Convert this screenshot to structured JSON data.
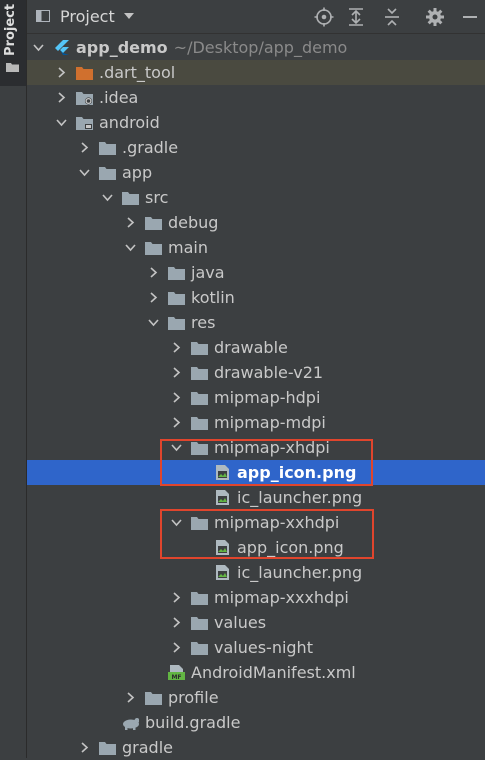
{
  "sidebar": {
    "tab_label": "Project"
  },
  "toolbar": {
    "title": "Project"
  },
  "tree": [
    {
      "label": "app_demo",
      "suffix": "~/Desktop/app_demo",
      "depth": 0,
      "arrow": "down",
      "icon": "flutter",
      "bold": true
    },
    {
      "label": ".dart_tool",
      "depth": 1,
      "arrow": "right",
      "icon": "folder-orange",
      "highlight": true
    },
    {
      "label": ".idea",
      "depth": 1,
      "arrow": "right",
      "icon": "folder-gear"
    },
    {
      "label": "android",
      "depth": 1,
      "arrow": "down",
      "icon": "folder-android"
    },
    {
      "label": ".gradle",
      "depth": 2,
      "arrow": "right",
      "icon": "folder"
    },
    {
      "label": "app",
      "depth": 2,
      "arrow": "down",
      "icon": "folder"
    },
    {
      "label": "src",
      "depth": 3,
      "arrow": "down",
      "icon": "folder"
    },
    {
      "label": "debug",
      "depth": 4,
      "arrow": "right",
      "icon": "folder"
    },
    {
      "label": "main",
      "depth": 4,
      "arrow": "down",
      "icon": "folder"
    },
    {
      "label": "java",
      "depth": 5,
      "arrow": "right",
      "icon": "folder"
    },
    {
      "label": "kotlin",
      "depth": 5,
      "arrow": "right",
      "icon": "folder"
    },
    {
      "label": "res",
      "depth": 5,
      "arrow": "down",
      "icon": "folder"
    },
    {
      "label": "drawable",
      "depth": 6,
      "arrow": "right",
      "icon": "folder"
    },
    {
      "label": "drawable-v21",
      "depth": 6,
      "arrow": "right",
      "icon": "folder"
    },
    {
      "label": "mipmap-hdpi",
      "depth": 6,
      "arrow": "right",
      "icon": "folder"
    },
    {
      "label": "mipmap-mdpi",
      "depth": 6,
      "arrow": "right",
      "icon": "folder"
    },
    {
      "label": "mipmap-xhdpi",
      "depth": 6,
      "arrow": "down",
      "icon": "folder"
    },
    {
      "label": "app_icon.png",
      "depth": 7,
      "arrow": "none",
      "icon": "image",
      "selected": true
    },
    {
      "label": "ic_launcher.png",
      "depth": 7,
      "arrow": "none",
      "icon": "image"
    },
    {
      "label": "mipmap-xxhdpi",
      "depth": 6,
      "arrow": "down",
      "icon": "folder"
    },
    {
      "label": "app_icon.png",
      "depth": 7,
      "arrow": "none",
      "icon": "image"
    },
    {
      "label": "ic_launcher.png",
      "depth": 7,
      "arrow": "none",
      "icon": "image"
    },
    {
      "label": "mipmap-xxxhdpi",
      "depth": 6,
      "arrow": "right",
      "icon": "folder"
    },
    {
      "label": "values",
      "depth": 6,
      "arrow": "right",
      "icon": "folder"
    },
    {
      "label": "values-night",
      "depth": 6,
      "arrow": "right",
      "icon": "folder"
    },
    {
      "label": "AndroidManifest.xml",
      "depth": 5,
      "arrow": "none",
      "icon": "manifest",
      "icon_text": "MF"
    },
    {
      "label": "profile",
      "depth": 4,
      "arrow": "right",
      "icon": "folder"
    },
    {
      "label": "build.gradle",
      "depth": 3,
      "arrow": "none",
      "icon": "gradle"
    },
    {
      "label": "gradle",
      "depth": 2,
      "arrow": "right",
      "icon": "folder"
    }
  ]
}
